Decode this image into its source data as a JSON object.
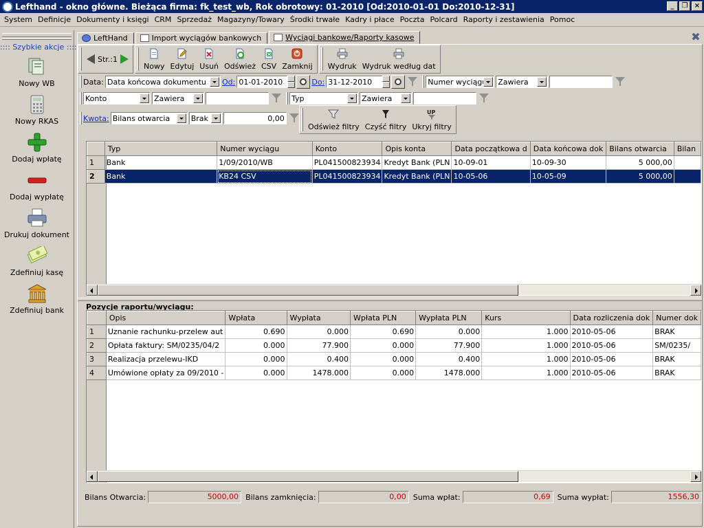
{
  "window": {
    "title": "Lefthand - okno główne. Bieżąca firma: fk_test_wb, Rok obrotowy: 01-2010 [Od:2010-01-01 Do:2010-12-31]",
    "minimize": "_",
    "maximize": "❐",
    "close": "×"
  },
  "menu": [
    "System",
    "Definicje",
    "Dokumenty i księgi",
    "CRM",
    "Sprzedaż",
    "Magazyny/Towary",
    "Środki trwałe",
    "Kadry i płace",
    "Poczta",
    "Polcard",
    "Raporty i zestawienia",
    "Pomoc"
  ],
  "sidebar": {
    "title": ":::: Szybkie akcje ::::",
    "items": [
      {
        "label": "Nowy WB",
        "icon": "document-stack-icon"
      },
      {
        "label": "Nowy RKAS",
        "icon": "calculator-icon"
      },
      {
        "label": "Dodaj wpłatę",
        "icon": "plus-icon"
      },
      {
        "label": "Dodaj wypłatę",
        "icon": "minus-icon"
      },
      {
        "label": "Drukuj dokument",
        "icon": "printer-icon"
      },
      {
        "label": "Zdefiniuj kasę",
        "icon": "money-icon"
      },
      {
        "label": "Zdefiniuj bank",
        "icon": "bank-icon"
      }
    ]
  },
  "tabs": [
    {
      "label": "LeftHand",
      "active": false
    },
    {
      "label": "Import wyciągów bankowych",
      "active": false
    },
    {
      "label": "Wyciągi bankowe/Raporty kasowe",
      "active": true
    }
  ],
  "toolbar": {
    "page": "Str.:1",
    "buttons": [
      {
        "label": "Nowy",
        "icon": "new-document-icon"
      },
      {
        "label": "Edytuj",
        "icon": "edit-icon"
      },
      {
        "label": "Usuń",
        "icon": "delete-icon"
      },
      {
        "label": "Odśwież",
        "icon": "refresh-icon"
      },
      {
        "label": "CSV",
        "icon": "csv-icon"
      },
      {
        "label": "Zamknij",
        "icon": "close-icon"
      }
    ],
    "print_buttons": [
      {
        "label": "Wydruk",
        "icon": "printer-icon"
      },
      {
        "label": "Wydruk według dat",
        "icon": "printer-icon"
      }
    ]
  },
  "filters": {
    "data_label": "Data:",
    "data_field": "Data końcowa dokumentu",
    "od_label": "Od:",
    "od_value": "01-01-2010",
    "do_label": "Do:",
    "do_value": "31-12-2010",
    "numer_field": "Numer wyciągu",
    "numer_cond": "Zawiera",
    "numer_value": "",
    "konto_field": "Konto",
    "konto_cond": "Zawiera",
    "konto_value": "",
    "typ_field": "Typ",
    "typ_cond": "Zawiera",
    "typ_value": "",
    "kwota_label": "Kwota:",
    "kwota_field": "Bilans otwarcia",
    "kwota_cond": "Brak",
    "kwota_value": "0,00",
    "refresh": "Odśwież filtry",
    "clear": "Czyść filtry",
    "hide": "Ukryj filtry"
  },
  "statements": {
    "columns": [
      "Typ",
      "Numer wyciągu",
      "Konto",
      "Opis konta",
      "Data początkowa d",
      "Data końcowa dok",
      "Bilans otwarcia",
      "Bilan"
    ],
    "rows": [
      {
        "n": "1",
        "typ": "Bank",
        "numer": "1/09/2010/WB",
        "konto": "PL041500823934",
        "opis": "Kredyt Bank (PLN",
        "od": "10-09-01",
        "do": "10-09-30",
        "bilans": "5 000,00",
        "b2": ""
      },
      {
        "n": "2",
        "typ": "Bank",
        "numer": "KB24 CSV",
        "konto": "PL041500823934",
        "opis": "Kredyt Bank (PLN",
        "od": "10-05-06",
        "do": "10-05-09",
        "bilans": "5 000,00",
        "b2": ""
      }
    ]
  },
  "positions": {
    "title": "Pozycje raportu/wyciągu:",
    "columns": [
      "Opis",
      "Wpłata",
      "Wypłata",
      "Wpłata PLN",
      "Wypłata PLN",
      "Kurs",
      "Data rozliczenia dok",
      "Numer dok"
    ],
    "rows": [
      {
        "n": "1",
        "opis": "Uznanie rachunku-przelew aut",
        "wplata": "0.690",
        "wyplata": "0.000",
        "wplata_pln": "0.690",
        "wyplata_pln": "0.000",
        "kurs": "1.000",
        "data": "2010-05-06",
        "numer": "BRAK"
      },
      {
        "n": "2",
        "opis": "Opłata faktury: SM/0235/04/2",
        "wplata": "0.000",
        "wyplata": "77.900",
        "wplata_pln": "0.000",
        "wyplata_pln": "77.900",
        "kurs": "1.000",
        "data": "2010-05-06",
        "numer": "SM/0235/"
      },
      {
        "n": "3",
        "opis": "Realizacja przelewu-IKD",
        "wplata": "0.000",
        "wyplata": "0.400",
        "wplata_pln": "0.000",
        "wyplata_pln": "0.400",
        "kurs": "1.000",
        "data": "2010-05-06",
        "numer": "BRAK"
      },
      {
        "n": "4",
        "opis": "Umówione opłaty za 09/2010 -",
        "wplata": "0.000",
        "wyplata": "1478.000",
        "wplata_pln": "0.000",
        "wyplata_pln": "1478.000",
        "kurs": "1.000",
        "data": "2010-05-06",
        "numer": "BRAK"
      }
    ]
  },
  "footer": {
    "bo_label": "Bilans Otwarcia:",
    "bo_value": "5000,00",
    "bz_label": "Bilans zamknięcia:",
    "bz_value": "0,00",
    "sw_label": "Suma wpłat:",
    "sw_value": "0,69",
    "sy_label": "Suma wypłat:",
    "sy_value": "1556,30"
  },
  "colors": {
    "title_bar": "#0a246a",
    "selection": "#0a246a",
    "totals": "#d00000",
    "link_label": "#1030c0"
  }
}
